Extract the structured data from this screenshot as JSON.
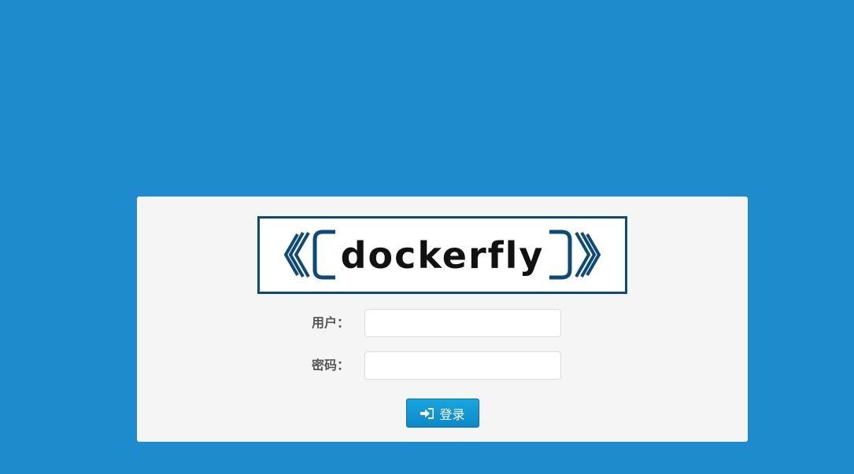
{
  "logo": {
    "text": "dockerfly",
    "border_color": "#0e4a78",
    "accent_color": "#0e4a78"
  },
  "form": {
    "username_label": "用户：",
    "username_value": "",
    "password_label": "密码：",
    "password_value": "",
    "submit_label": "登录",
    "submit_icon": "sign-in-icon"
  },
  "colors": {
    "background": "#1e8bcd",
    "panel": "#f5f5f5",
    "button": "#0b88c8"
  }
}
